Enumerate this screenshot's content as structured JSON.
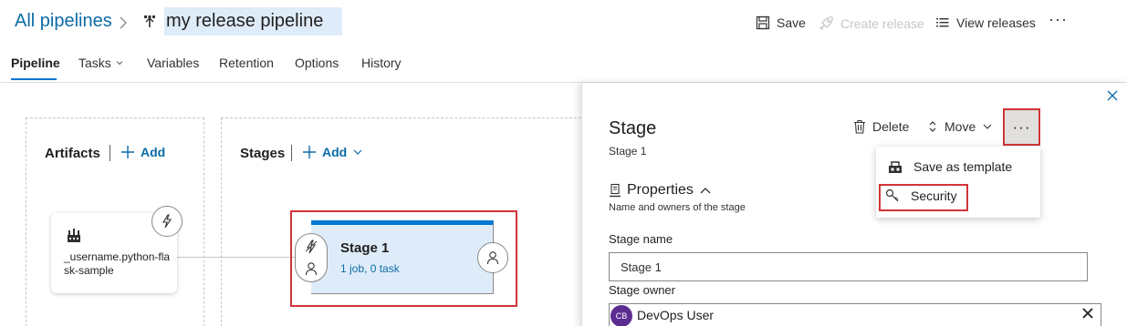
{
  "header": {
    "breadcrumb_root": "All pipelines",
    "breadcrumb_separator": ">",
    "pipeline_name": "my release pipeline",
    "save_label": "Save",
    "create_release_label": "Create release",
    "view_releases_label": "View releases",
    "more_label": "···"
  },
  "tabs": [
    {
      "label": "Pipeline",
      "selected": true
    },
    {
      "label": "Tasks",
      "has_dropdown": true
    },
    {
      "label": "Variables"
    },
    {
      "label": "Retention"
    },
    {
      "label": "Options"
    },
    {
      "label": "History"
    }
  ],
  "canvas": {
    "artifacts": {
      "title": "Artifacts",
      "add_label": "Add",
      "artifact_name": "_username.python-flask-sample"
    },
    "stages": {
      "title": "Stages",
      "add_label": "Add",
      "stage": {
        "name": "Stage 1",
        "summary": "1 job, 0 task"
      }
    }
  },
  "panel": {
    "title": "Stage",
    "subtitle": "Stage 1",
    "delete_label": "Delete",
    "move_label": "Move",
    "more_label": "···",
    "properties_title": "Properties",
    "properties_description": "Name and owners of the stage",
    "stage_name_label": "Stage name",
    "stage_name_value": "Stage 1",
    "stage_owner_label": "Stage owner",
    "owner": {
      "initials": "CB",
      "name": "DevOps User"
    }
  },
  "dropdown": {
    "items": [
      {
        "label": "Save as template",
        "icon": "template-icon"
      },
      {
        "label": "Security",
        "icon": "key-icon"
      }
    ]
  },
  "colors": {
    "accent": "#0078d4",
    "link": "#0b6ba8",
    "highlight": "#d13438",
    "stage_fill": "#deecf9",
    "avatar": "#5c2d91"
  }
}
